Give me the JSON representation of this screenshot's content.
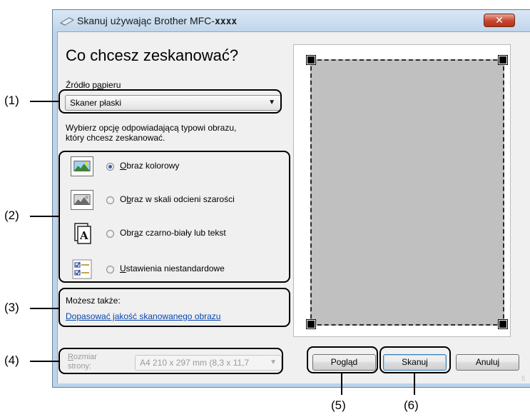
{
  "window": {
    "title_prefix": "Skanuj używając Brother MFC-",
    "title_model": "xxxx",
    "close_symbol": "✕"
  },
  "dialog": {
    "heading": "Co chcesz zeskanować?",
    "paper_source": {
      "label_before": "Źródło p",
      "label_underline": "a",
      "label_after": "pieru",
      "selected": "Skaner płaski"
    },
    "instruction_line1": "Wybierz opcję odpowiadającą typowi obrazu,",
    "instruction_line2": "który chcesz zeskanować.",
    "options": [
      {
        "pre": "",
        "ul": "O",
        "post": "braz kolorowy",
        "selected": true,
        "icon": "color-photo-icon"
      },
      {
        "pre": "O",
        "ul": "b",
        "post": "raz w skali odcieni szarości",
        "selected": false,
        "icon": "grayscale-photo-icon"
      },
      {
        "pre": "Obr",
        "ul": "a",
        "post": "z czarno-biały lub tekst",
        "selected": false,
        "icon": "text-document-icon"
      },
      {
        "pre": "",
        "ul": "U",
        "post": "stawienia niestandardowe",
        "selected": false,
        "icon": "custom-settings-icon"
      }
    ],
    "also_label": "Możesz także:",
    "adjust_link": "Dopasować jakość skanowanego obrazu",
    "page_size": {
      "label_ul": "R",
      "label_rest": "ozmiar",
      "label_line2": "strony:",
      "value": "A4 210 x 297 mm (8,3 x 11,7"
    },
    "buttons": {
      "preview_pre": "Po",
      "preview_ul": "g",
      "preview_post": "ląd",
      "scan": "Skanuj",
      "cancel": "Anuluj"
    }
  },
  "callouts": {
    "c1": "(1)",
    "c2": "(2)",
    "c3": "(3)",
    "c4": "(4)",
    "c5": "(5)",
    "c6": "(6)"
  }
}
